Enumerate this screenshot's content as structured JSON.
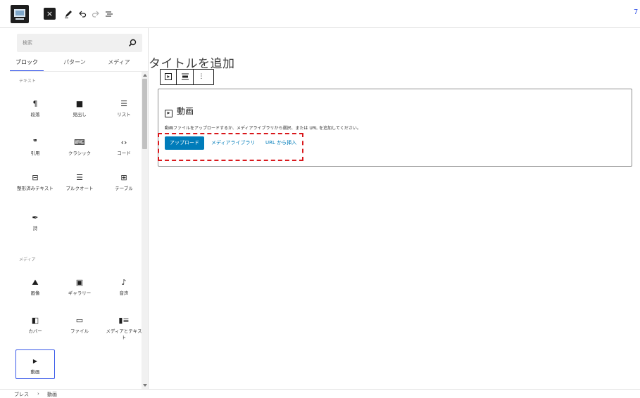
{
  "toolbar": {
    "close_icon": "×",
    "pen_icon": "pen-icon",
    "undo_icon": "undo-icon",
    "redo_icon": "redo-icon",
    "list_view_icon": "list-view-icon",
    "right_fragment": "7"
  },
  "sidebar": {
    "search_placeholder": "検索",
    "tabs": [
      "ブロック",
      "パターン",
      "メディア"
    ],
    "categories": {
      "text": "テキスト",
      "media": "メディア"
    },
    "text_blocks": [
      {
        "icon": "¶",
        "label": "段落",
        "name": "paragraph"
      },
      {
        "icon": "■",
        "label": "見出し",
        "name": "heading"
      },
      {
        "icon": "☰",
        "label": "リスト",
        "name": "list"
      },
      {
        "icon": "❞",
        "label": "引用",
        "name": "quote"
      },
      {
        "icon": "⌨",
        "label": "クラシック",
        "name": "classic"
      },
      {
        "icon": "‹›",
        "label": "コード",
        "name": "code"
      },
      {
        "icon": "⊟",
        "label": "整形済みテキスト",
        "name": "preformatted"
      },
      {
        "icon": "☰",
        "label": "プルクオート",
        "name": "pullquote"
      },
      {
        "icon": "⊞",
        "label": "テーブル",
        "name": "table"
      },
      {
        "icon": "✒",
        "label": "詩",
        "name": "verse"
      }
    ],
    "media_blocks": [
      {
        "icon": "⛰",
        "label": "画像",
        "name": "image"
      },
      {
        "icon": "▣",
        "label": "ギャラリー",
        "name": "gallery"
      },
      {
        "icon": "♪",
        "label": "音声",
        "name": "audio"
      },
      {
        "icon": "◧",
        "label": "カバー",
        "name": "cover"
      },
      {
        "icon": "▭",
        "label": "ファイル",
        "name": "file"
      },
      {
        "icon": "▮≡",
        "label": "メディアとテキスト",
        "name": "media-text"
      },
      {
        "icon": "▶",
        "label": "動画",
        "name": "video"
      }
    ]
  },
  "editor": {
    "title_placeholder": "タイトルを追加",
    "block_toolbar": {
      "type_icon": "▶",
      "align_icon": "≡",
      "more_icon": "⋮"
    },
    "video_block": {
      "icon": "▶",
      "title": "動画",
      "instructions": "動画ファイルをアップロードするか、メディアライブラリから選択、または URL を追加してください。",
      "upload_label": "アップロード",
      "media_library_label": "メディアライブラリ",
      "insert_url_label": "URL から挿入"
    }
  },
  "footer": {
    "breadcrumb": [
      "ブレス",
      "動画"
    ],
    "separator": "›"
  },
  "colors": {
    "accent": "#007cba",
    "tab_underline": "#3858e9",
    "highlight": "#d9171b"
  }
}
